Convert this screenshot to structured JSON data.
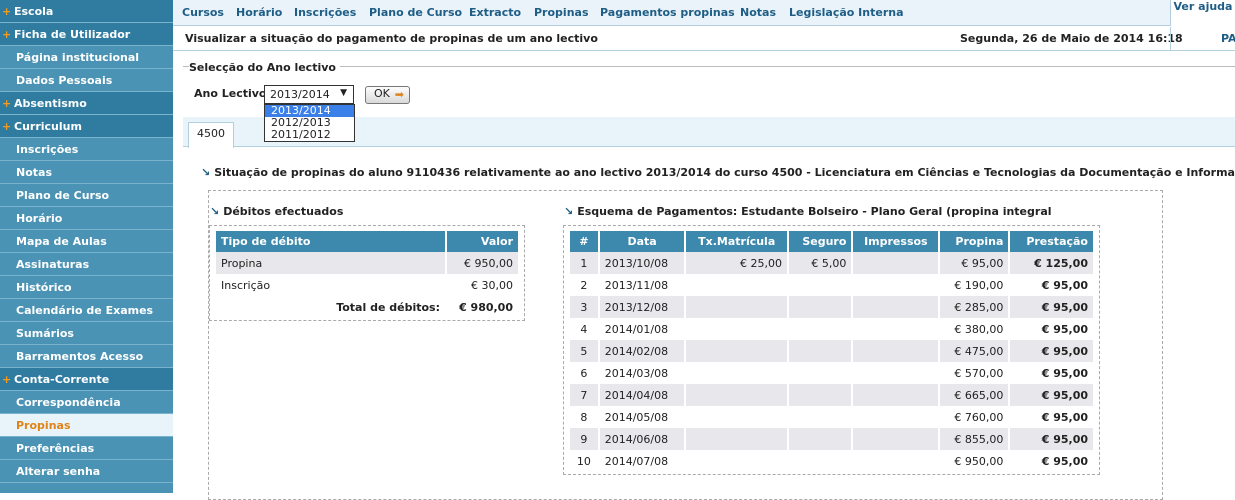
{
  "sidebar": {
    "items": [
      {
        "label": "Escola",
        "section": true
      },
      {
        "label": "Ficha de Utilizador",
        "section": true
      },
      {
        "label": "Página institucional",
        "section": false
      },
      {
        "label": "Dados Pessoais",
        "section": false
      },
      {
        "label": "Absentismo",
        "section": true
      },
      {
        "label": "Curriculum",
        "section": true
      },
      {
        "label": "Inscrições",
        "section": false
      },
      {
        "label": "Notas",
        "section": false
      },
      {
        "label": "Plano de Curso",
        "section": false
      },
      {
        "label": "Horário",
        "section": false
      },
      {
        "label": "Mapa de Aulas",
        "section": false
      },
      {
        "label": "Assinaturas",
        "section": false
      },
      {
        "label": "Histórico",
        "section": false
      },
      {
        "label": "Calendário de Exames",
        "section": false
      },
      {
        "label": "Sumários",
        "section": false
      },
      {
        "label": "Barramentos Acesso",
        "section": false
      },
      {
        "label": "Conta-Corrente",
        "section": true
      },
      {
        "label": "Correspondência",
        "section": false
      },
      {
        "label": "Propinas",
        "section": false,
        "active": true
      },
      {
        "label": "Preferências",
        "section": false
      },
      {
        "label": "Alterar senha",
        "section": false
      }
    ]
  },
  "topnav": {
    "links": [
      "Cursos",
      "Horário",
      "Inscrições",
      "Plano de Curso",
      "Extracto",
      "Propinas",
      "Pagamentos propinas",
      "Notas",
      "Legislação Interna"
    ],
    "help": "Ver ajuda"
  },
  "subheader": {
    "description": "Visualizar a situação do pagamento de propinas de um ano lectivo",
    "date": "Segunda, 26 de Maio de 2014 16:18",
    "user_abbr": "PA"
  },
  "year_selection": {
    "legend": "Selecção do Ano lectivo",
    "label": "Ano Lectivo",
    "selected": "2013/2014",
    "options": [
      "2013/2014",
      "2012/2013",
      "2011/2012"
    ],
    "ok_label": "OK"
  },
  "tabs": [
    "4500"
  ],
  "heading": "Situação de propinas do aluno 9110436 relativamente ao ano lectivo 2013/2014 do curso 4500 - Licenciatura em Ciências e Tecnologias da Documentação e Informação",
  "debitos": {
    "title": "Débitos efectuados",
    "columns": [
      "Tipo de débito",
      "Valor"
    ],
    "rows": [
      {
        "tipo": "Propina",
        "valor": "€ 950,00"
      },
      {
        "tipo": "Inscrição",
        "valor": "€ 30,00"
      }
    ],
    "total_label": "Total de débitos:",
    "total_value": "€ 980,00"
  },
  "esquema": {
    "title": "Esquema de Pagamentos: Estudante Bolseiro - Plano Geral (propina integral",
    "columns": [
      "#",
      "Data",
      "Tx.Matrícula",
      "Seguro",
      "Impressos",
      "Propina",
      "Prestação"
    ],
    "rows": [
      [
        "1",
        "2013/10/08",
        "€ 25,00",
        "€ 5,00",
        "",
        "€ 95,00",
        "€ 125,00"
      ],
      [
        "2",
        "2013/11/08",
        "",
        "",
        "",
        "€ 190,00",
        "€ 95,00"
      ],
      [
        "3",
        "2013/12/08",
        "",
        "",
        "",
        "€ 285,00",
        "€ 95,00"
      ],
      [
        "4",
        "2014/01/08",
        "",
        "",
        "",
        "€ 380,00",
        "€ 95,00"
      ],
      [
        "5",
        "2014/02/08",
        "",
        "",
        "",
        "€ 475,00",
        "€ 95,00"
      ],
      [
        "6",
        "2014/03/08",
        "",
        "",
        "",
        "€ 570,00",
        "€ 95,00"
      ],
      [
        "7",
        "2014/04/08",
        "",
        "",
        "",
        "€ 665,00",
        "€ 95,00"
      ],
      [
        "8",
        "2014/05/08",
        "",
        "",
        "",
        "€ 760,00",
        "€ 95,00"
      ],
      [
        "9",
        "2014/06/08",
        "",
        "",
        "",
        "€ 855,00",
        "€ 95,00"
      ],
      [
        "10",
        "2014/07/08",
        "",
        "",
        "",
        "€ 950,00",
        "€ 95,00"
      ]
    ]
  },
  "colors": {
    "sidebar_bg": "#4a93b5",
    "section_bg": "#2f7ca0",
    "accent_orange": "#e08318",
    "table_header": "#3d88ad",
    "nav_link": "#1e5d86"
  },
  "icons": {
    "section_marker": "plus-icon",
    "heading_marker": "arrow-down-right-icon",
    "ok_arrow": "arrow-right-icon",
    "select_arrow": "triangle-down-icon"
  }
}
